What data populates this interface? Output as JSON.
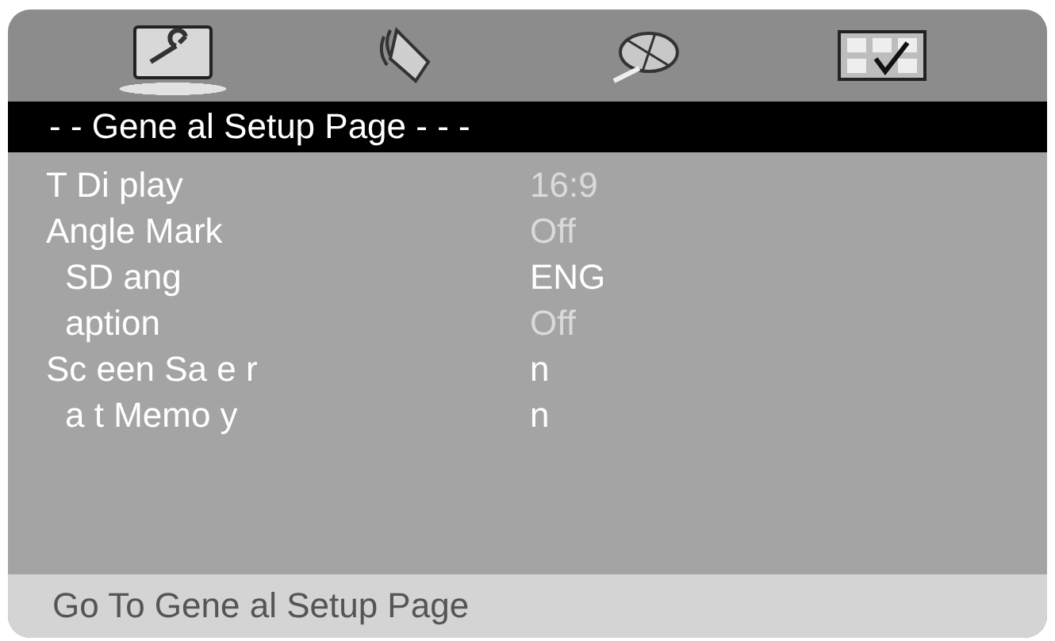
{
  "tabs": [
    {
      "kind": "wrench",
      "selected": true
    },
    {
      "kind": "speaker",
      "selected": false
    },
    {
      "kind": "disc",
      "selected": false
    },
    {
      "kind": "grid",
      "selected": false
    }
  ],
  "header": {
    "title": "- - Gene al Setup Page - - -"
  },
  "settings": [
    {
      "label": "T  Di play",
      "value": "16:9",
      "disabled": true,
      "indented": false
    },
    {
      "label": "Angle Mark",
      "value": "Off",
      "disabled": true,
      "indented": false
    },
    {
      "label": "SD  ang",
      "value": "ENG",
      "disabled": false,
      "indented": true
    },
    {
      "label": "aption",
      "value": "Off",
      "disabled": true,
      "indented": true
    },
    {
      "label": "Sc een Sa e r",
      "value": "n",
      "disabled": false,
      "indented": false
    },
    {
      "label": "a t Memo y",
      "value": "n",
      "disabled": false,
      "indented": true
    }
  ],
  "status_bar": {
    "text": "Go To Gene al Setup Page"
  }
}
